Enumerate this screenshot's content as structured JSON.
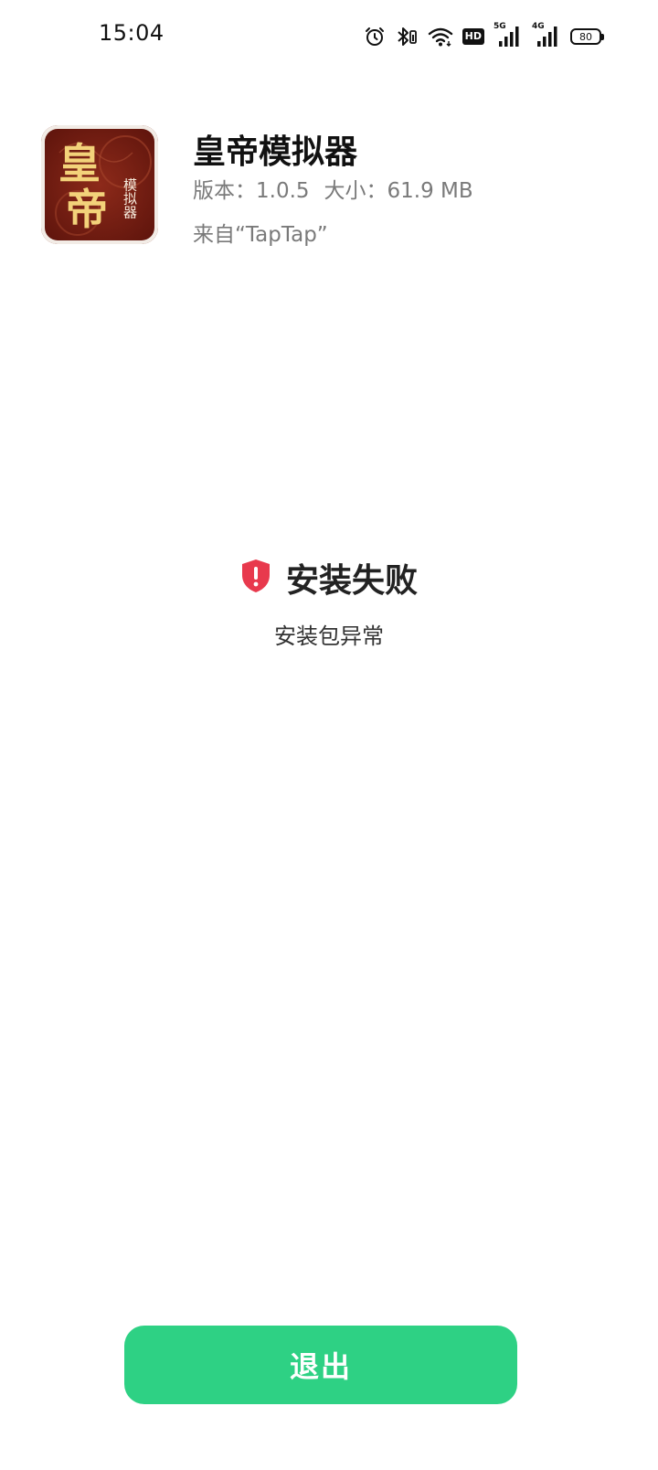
{
  "status_bar": {
    "time": "15:04",
    "hd_label": "HD",
    "network_1": "5G",
    "network_2": "4G",
    "battery": "80"
  },
  "app": {
    "name": "皇帝模拟器",
    "version": "版本：1.0.5",
    "size": "大小：61.9 MB",
    "source": "来自“TapTap”",
    "icon_text_large_1": "皇",
    "icon_text_large_2": "帝",
    "icon_text_small": "模拟器"
  },
  "result": {
    "title": "安装失败",
    "description": "安装包异常",
    "icon": "shield-alert-icon",
    "icon_color": "#e8394d"
  },
  "actions": {
    "exit_label": "退出",
    "exit_color": "#2ed184"
  }
}
